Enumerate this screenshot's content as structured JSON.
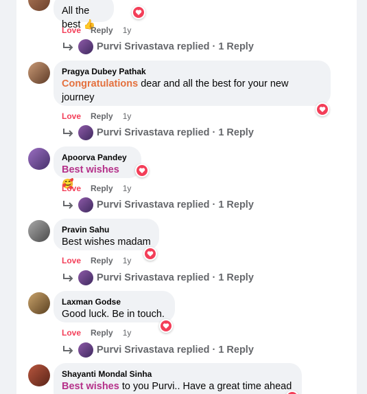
{
  "comments": [
    {
      "author": "",
      "text_plain": "All the best",
      "emoji": "👍",
      "actions": {
        "love": "Love",
        "reply": "Reply",
        "time": "1y"
      },
      "replied": {
        "name": "Purvi Srivastava",
        "label": "replied · 1 Reply"
      }
    },
    {
      "author": "Pragya Dubey Pathak",
      "text_highlight": "Congratulations",
      "text_rest": " dear and all the best for your new journey",
      "actions": {
        "love": "Love",
        "reply": "Reply",
        "time": "1y"
      },
      "replied": {
        "name": "Purvi Srivastava",
        "label": "replied · 1 Reply"
      }
    },
    {
      "author": "Apoorva Pandey",
      "text_highlight": "Best wishes",
      "emoji": "🥰",
      "actions": {
        "love": "Love",
        "reply": "Reply",
        "time": "1y"
      },
      "replied": {
        "name": "Purvi Srivastava",
        "label": "replied · 1 Reply"
      }
    },
    {
      "author": "Pravin Sahu",
      "text_plain": "Best wishes madam",
      "actions": {
        "love": "Love",
        "reply": "Reply",
        "time": "1y"
      },
      "replied": {
        "name": "Purvi Srivastava",
        "label": "replied · 1 Reply"
      }
    },
    {
      "author": "Laxman Godse",
      "text_plain": "Good luck. Be in touch.",
      "actions": {
        "love": "Love",
        "reply": "Reply",
        "time": "1y"
      },
      "replied": {
        "name": "Purvi Srivastava",
        "label": "replied · 1 Reply"
      }
    },
    {
      "author": "Shayanti Mondal Sinha",
      "text_highlight": "Best wishes",
      "text_rest": " to you Purvi.. Have a great time ahead"
    }
  ],
  "icons": {
    "reaction": "love-heart-icon",
    "reply_arrow": "reply-arrow-icon"
  },
  "colors": {
    "love": "#f33e58",
    "highlight_orange": "#e4703d",
    "highlight_purple": "#b5318a",
    "bubble": "#f0f2f5"
  }
}
